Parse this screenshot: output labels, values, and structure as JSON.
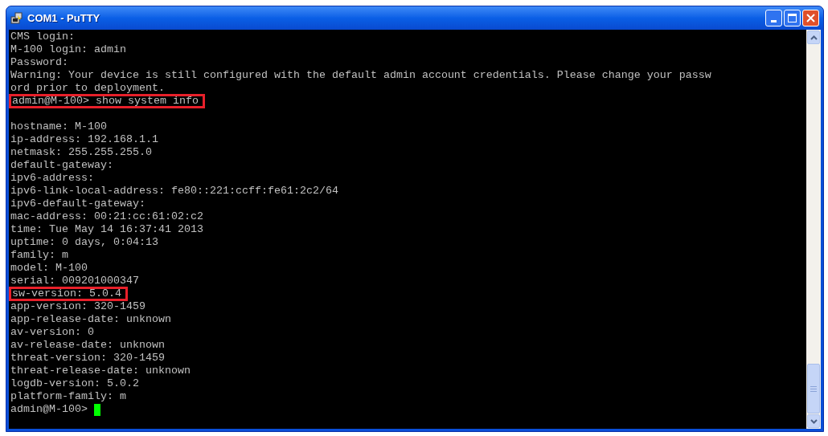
{
  "window": {
    "title": "COM1 - PuTTY"
  },
  "terminal": {
    "lines": [
      {
        "kind": "line",
        "text": "CMS login:",
        "highlighted": false
      },
      {
        "kind": "line",
        "text": "M-100 login: admin",
        "highlighted": false
      },
      {
        "kind": "line",
        "text": "Password:",
        "highlighted": false
      },
      {
        "kind": "line",
        "text": "Warning: Your device is still configured with the default admin account credentials. Please change your passw",
        "highlighted": false
      },
      {
        "kind": "line",
        "text": "ord prior to deployment.",
        "highlighted": false
      },
      {
        "kind": "line",
        "text": "admin@M-100> show system info",
        "highlighted": true
      },
      {
        "kind": "blank"
      },
      {
        "kind": "line",
        "text": "hostname: M-100",
        "highlighted": false
      },
      {
        "kind": "line",
        "text": "ip-address: 192.168.1.1",
        "highlighted": false
      },
      {
        "kind": "line",
        "text": "netmask: 255.255.255.0",
        "highlighted": false
      },
      {
        "kind": "line",
        "text": "default-gateway:",
        "highlighted": false
      },
      {
        "kind": "line",
        "text": "ipv6-address:",
        "highlighted": false
      },
      {
        "kind": "line",
        "text": "ipv6-link-local-address: fe80::221:ccff:fe61:2c2/64",
        "highlighted": false
      },
      {
        "kind": "line",
        "text": "ipv6-default-gateway:",
        "highlighted": false
      },
      {
        "kind": "line",
        "text": "mac-address: 00:21:cc:61:02:c2",
        "highlighted": false
      },
      {
        "kind": "line",
        "text": "time: Tue May 14 16:37:41 2013",
        "highlighted": false
      },
      {
        "kind": "line",
        "text": "uptime: 0 days, 0:04:13",
        "highlighted": false
      },
      {
        "kind": "line",
        "text": "family: m",
        "highlighted": false
      },
      {
        "kind": "line",
        "text": "model: M-100",
        "highlighted": false
      },
      {
        "kind": "line",
        "text": "serial: 009201000347",
        "highlighted": false
      },
      {
        "kind": "line",
        "text": "sw-version: 5.0.4",
        "highlighted": true
      },
      {
        "kind": "line",
        "text": "app-version: 320-1459",
        "highlighted": false
      },
      {
        "kind": "line",
        "text": "app-release-date: unknown",
        "highlighted": false
      },
      {
        "kind": "line",
        "text": "av-version: 0",
        "highlighted": false
      },
      {
        "kind": "line",
        "text": "av-release-date: unknown",
        "highlighted": false
      },
      {
        "kind": "line",
        "text": "threat-version: 320-1459",
        "highlighted": false
      },
      {
        "kind": "line",
        "text": "threat-release-date: unknown",
        "highlighted": false
      },
      {
        "kind": "line",
        "text": "logdb-version: 5.0.2",
        "highlighted": false
      },
      {
        "kind": "line",
        "text": "platform-family: m",
        "highlighted": false
      }
    ],
    "prompt": {
      "text": "admin@M-100>",
      "cursor": true
    }
  }
}
